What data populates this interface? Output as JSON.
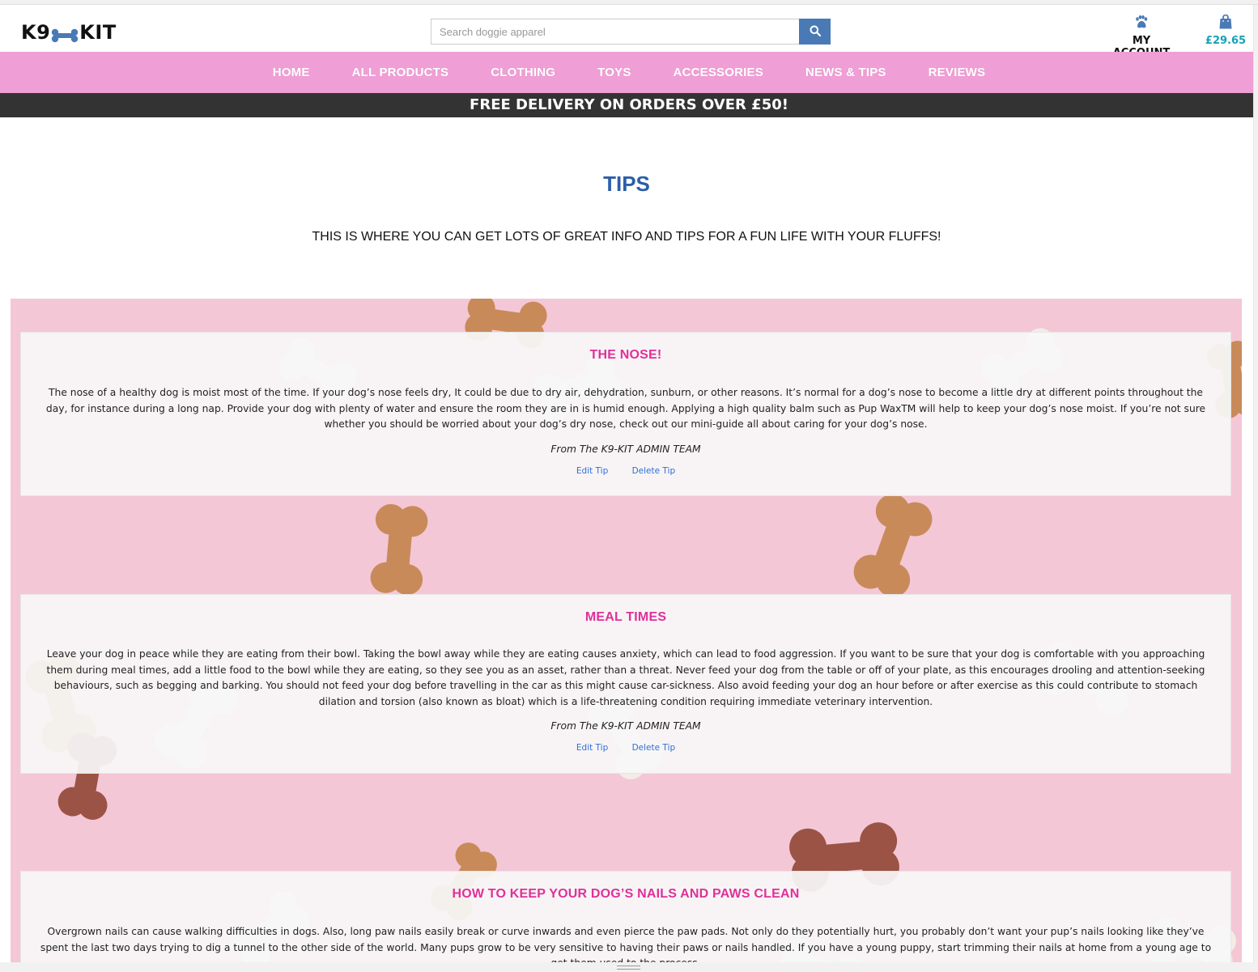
{
  "header": {
    "logo_left": "K9",
    "logo_right": "KIT",
    "search_placeholder": "Search doggie apparel",
    "account_label": "MY ACCOUNT",
    "cart_total": "£29.65"
  },
  "nav": {
    "items": [
      {
        "label": "HOME"
      },
      {
        "label": "ALL PRODUCTS"
      },
      {
        "label": "CLOTHING"
      },
      {
        "label": "TOYS"
      },
      {
        "label": "ACCESSORIES"
      },
      {
        "label": "NEWS & TIPS"
      },
      {
        "label": "REVIEWS"
      }
    ]
  },
  "banner": "FREE DELIVERY ON ORDERS OVER £50!",
  "page": {
    "title": "TIPS",
    "subtitle": "THIS IS WHERE YOU CAN GET LOTS OF GREAT INFO AND TIPS FOR A FUN LIFE WITH YOUR FLUFFS!"
  },
  "tips": [
    {
      "title": "THE NOSE!",
      "body": "The nose of a healthy dog is moist most of the time. If your dog’s nose feels dry, It could be due to dry air, dehydration, sunburn, or other reasons. It’s normal for a dog’s nose to become a little dry at different points throughout the day, for instance during a long nap. Provide your dog with plenty of water and ensure the room they are in is humid enough. Applying a high quality balm such as Pup WaxTM will help to keep your dog’s nose moist. If you’re not sure whether you should be worried about your dog’s dry nose, check out our mini-guide all about caring for your dog’s nose.",
      "author": "From The K9-KIT ADMIN TEAM",
      "edit_label": "Edit Tip",
      "delete_label": "Delete Tip"
    },
    {
      "title": "MEAL TIMES",
      "body": "Leave your dog in peace while they are eating from their bowl. Taking the bowl away while they are eating causes anxiety, which can lead to food aggression. If you want to be sure that your dog is comfortable with you approaching them during meal times, add a little food to the bowl while they are eating, so they see you as an asset, rather than a threat. Never feed your dog from the table or off of your plate, as this encourages drooling and attention-seeking behaviours, such as begging and barking. You should not feed your dog before travelling in the car as this might cause car-sickness. Also avoid feeding your dog an hour before or after exercise as this could contribute to stomach dilation and torsion (also known as bloat) which is a life-threatening condition requiring immediate veterinary intervention.",
      "author": "From The K9-KIT ADMIN TEAM",
      "edit_label": "Edit Tip",
      "delete_label": "Delete Tip"
    },
    {
      "title": "HOW TO KEEP YOUR DOG’S NAILS AND PAWS CLEAN",
      "body": "Overgrown nails can cause walking difficulties in dogs. Also, long paw nails easily break or curve inwards and even pierce the paw pads. Not only do they potentially hurt, you probably don’t want your pup’s nails looking like they’ve spent the last two days trying to dig a tunnel to the other side of the world. Many pups grow to be very sensitive to having their paws or nails handled. If you have a young puppy, start trimming their nails at home from a young age to get them used to the process."
    }
  ],
  "colors": {
    "nav_bg": "#ef9fd5",
    "banner_bg": "#333333",
    "title_blue": "#2c5ea8",
    "tip_title_pink": "#e0309a",
    "search_button": "#4a7ab5",
    "cart_teal": "#17a2b8",
    "link_blue": "#2f6fd6"
  },
  "icons": {
    "search": "search-icon",
    "account": "paw-icon",
    "cart": "shopping-bag-icon",
    "logo": "bone-icon"
  }
}
